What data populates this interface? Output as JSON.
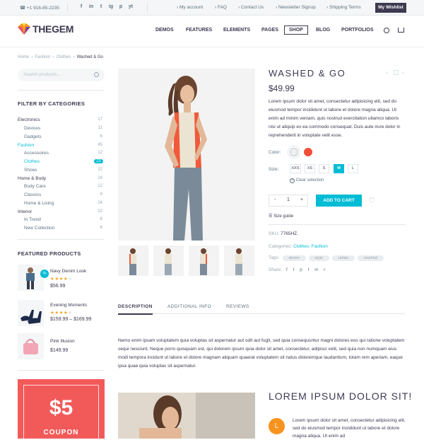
{
  "topbar": {
    "phone": "+1 916-85-2235",
    "social": [
      "f",
      "in",
      "t",
      "ig",
      "p",
      "yt"
    ],
    "links": [
      "My account",
      "FAQ",
      "Contact Us",
      "Newsletter Signup",
      "Shipping Terms"
    ],
    "wishlist": "My Wishlist"
  },
  "logo": {
    "text": "THEGEM"
  },
  "nav": [
    "DEMOS",
    "FEATURES",
    "ELEMENTS",
    "PAGES",
    "SHOP",
    "BLOG",
    "PORTFOLIOS"
  ],
  "breadcrumb": [
    "Home",
    "Fashion",
    "Clothes",
    "Washed & Go"
  ],
  "search": {
    "placeholder": "Search products..."
  },
  "sidebar": {
    "categories_title": "FILTER BY CATEGORIES",
    "categories": [
      {
        "label": "Electronics",
        "count": "17"
      },
      {
        "label": "Devices",
        "count": "11"
      },
      {
        "label": "Gadgets",
        "count": "6"
      },
      {
        "label": "Fashion",
        "count": "45"
      },
      {
        "label": "Accessoires",
        "count": "12"
      },
      {
        "label": "Clothes",
        "count": "21"
      },
      {
        "label": "Shoes",
        "count": "12"
      },
      {
        "label": "Home & Body",
        "count": "24"
      },
      {
        "label": "Body Care",
        "count": "12"
      },
      {
        "label": "Classics",
        "count": "6"
      },
      {
        "label": "Home & Living",
        "count": "24"
      },
      {
        "label": "Interior",
        "count": "22"
      },
      {
        "label": "In Trend",
        "count": "6"
      },
      {
        "label": "New Collection",
        "count": "6"
      }
    ],
    "featured_title": "FEATURED PRODUCTS",
    "featured": [
      {
        "name": "Navy Denim Look",
        "price": "$56.99",
        "rating": 4,
        "badge": "%"
      },
      {
        "name": "Evening Moments",
        "price": "$159.99 – $169.99",
        "rating": 4
      },
      {
        "name": "Pink Illusion",
        "price": "$149.99"
      }
    ],
    "coupon": {
      "amount": "$5",
      "label": "COUPON"
    }
  },
  "product": {
    "title": "WASHED & GO",
    "price": "$49.99",
    "description": "Lorem ipsum dolor sit amet, consectetur adipisicing elit, sed do eiusmod tempor incididunt ut labore et dolore magna aliqua. Ut enim ad minim veniam, quis nostrud exercitation ullamco laboris nisi ut aliquip ex ea commodo consequat. Duis aute irure dolor in reprehenderit in voluptate velit esse.",
    "color_label": "Color:",
    "colors": [
      "#f0f0f0",
      "#f04e37"
    ],
    "size_label": "Size:",
    "sizes": [
      "XXS",
      "XS",
      "S",
      "M",
      "L"
    ],
    "selected_size": "M",
    "clear_selection": "Clear selection",
    "quantity": "1",
    "add_to_cart": "ADD TO CART",
    "size_guide": "Size guide",
    "sku_label": "SKU:",
    "sku": "7765HZ.",
    "categories_label": "Categories:",
    "categories": [
      "Clothes",
      "Fashion"
    ],
    "tags_label": "Tags:",
    "tags": [
      "denim",
      "style",
      "urban",
      "washed"
    ],
    "share_label": "Share:",
    "share_icons": [
      "f",
      "t",
      "p",
      "t",
      "in",
      "r"
    ]
  },
  "tabs": [
    "DESCRIPTION",
    "ADDITIONAL INFO",
    "REVIEWS"
  ],
  "description_text": "Nemo enim ipsam voluptatem quia voluptas sit aspernatur aut odit aut fugit, sed quia consequuntur magni dolores eos qui ratione voluptatem sequi nesciunt. Neque porro quisquam est, qui dolorem ipsum quia dolor sit amet, consectetur, adipisci velit, sed quia non numquam eius modi tempora incidunt ut labore et dolore magnam aliquam quaerat voluptatem sit natus doloremque laudantium, totam rem aperiam, eaque ipsa quae quia voluptas sit aspernatur.",
  "lorem": {
    "title": "LOREM IPSUM DOLOR SIT!",
    "avatar_letter": "L",
    "text": "Lorem ipsum dolor sit amet, consectetur adipisicing elit, sed do eiusmod tempor incididunt ut labore et dolore magna aliqua. Ut enim ad"
  },
  "colors": {
    "accent": "#00bcd4",
    "dark": "#3c3950",
    "coupon": "#f25a5a",
    "avatar": "#f7931e"
  }
}
